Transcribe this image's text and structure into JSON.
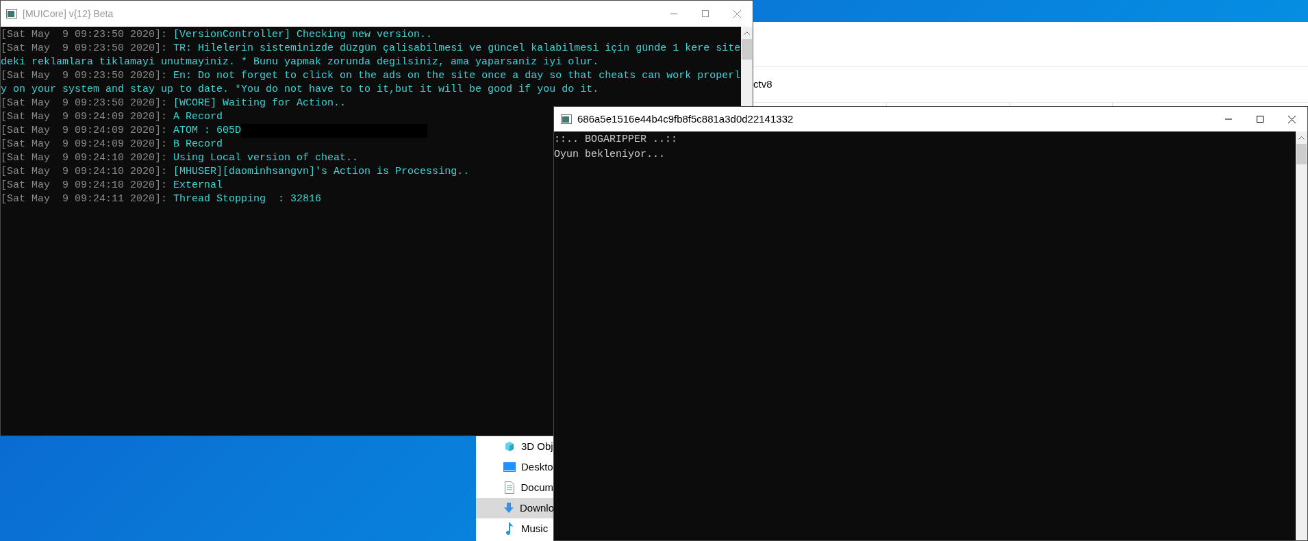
{
  "explorer": {
    "address": "ctv8",
    "nav_items": [
      {
        "label": "3D Obj",
        "kind": "cube",
        "selected": false
      },
      {
        "label": "Deskto",
        "kind": "desktop",
        "selected": false
      },
      {
        "label": "Docum",
        "kind": "document",
        "selected": false
      },
      {
        "label": "Downlo",
        "kind": "download",
        "selected": true
      },
      {
        "label": "Music",
        "kind": "music",
        "selected": false
      }
    ]
  },
  "console_main": {
    "title": "[MUICore] v{12} Beta",
    "active": false,
    "lines": [
      {
        "kind": "log",
        "timestamp": "[Sat May  9 09:23:50 2020]:",
        "message": "[VersionController] Checking new version.."
      },
      {
        "kind": "log",
        "timestamp": "[Sat May  9 09:23:50 2020]:",
        "message": "TR: Hilelerin sisteminizde düzgün çalisabilmesi ve güncel kalabilmesi için günde 1 kere site"
      },
      {
        "kind": "wrap",
        "message": "deki reklamlara tiklamayi unutmayiniz. * Bunu yapmak zorunda degilsiniz, ama yaparsaniz iyi olur."
      },
      {
        "kind": "log",
        "timestamp": "[Sat May  9 09:23:50 2020]:",
        "message": "En: Do not forget to click on the ads on the site once a day so that cheats can work properl"
      },
      {
        "kind": "wrap",
        "message": "y on your system and stay up to date. *You do not have to to it,but it will be good if you do it."
      },
      {
        "kind": "log",
        "timestamp": "[Sat May  9 09:23:50 2020]:",
        "message": "[WCORE] Waiting for Action.."
      },
      {
        "kind": "log",
        "timestamp": "[Sat May  9 09:24:09 2020]:",
        "message": "A Record"
      },
      {
        "kind": "redacted",
        "timestamp": "[Sat May  9 09:24:09 2020]:",
        "message": "ATOM : 605D"
      },
      {
        "kind": "log",
        "timestamp": "[Sat May  9 09:24:09 2020]:",
        "message": "B Record"
      },
      {
        "kind": "log",
        "timestamp": "[Sat May  9 09:24:10 2020]:",
        "message": "Using Local version of cheat.."
      },
      {
        "kind": "log",
        "timestamp": "[Sat May  9 09:24:10 2020]:",
        "message": "[MHUSER][daominhsangvn]'s Action is Processing.."
      },
      {
        "kind": "log",
        "timestamp": "[Sat May  9 09:24:10 2020]:",
        "message": "External"
      },
      {
        "kind": "log",
        "timestamp": "[Sat May  9 09:24:11 2020]:",
        "message": "Thread Stopping  : 32816"
      }
    ]
  },
  "console_game": {
    "title": "686a5e1516e44b4c9fb8f5c881a3d0d22141332",
    "active": true,
    "lines": [
      {
        "kind": "plain",
        "message": "::.. BOGARIPPER ..::"
      },
      {
        "kind": "plain",
        "message": "Oyun bekleniyor..."
      }
    ]
  }
}
